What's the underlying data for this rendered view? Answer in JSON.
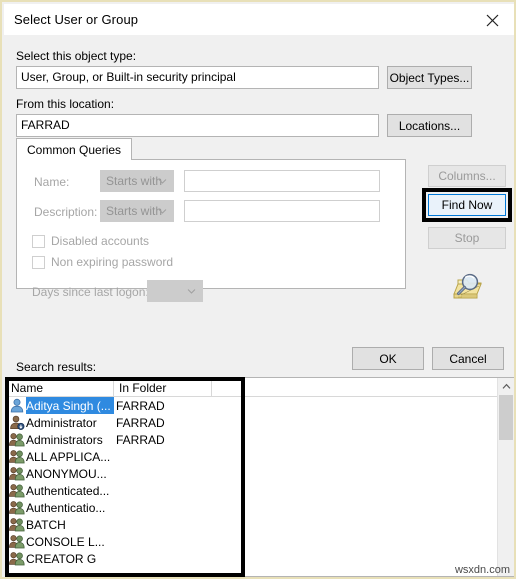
{
  "window": {
    "title": "Select User or Group",
    "close_icon": "close-icon"
  },
  "object_type": {
    "label": "Select this object type:",
    "value": "User, Group, or Built-in security principal",
    "button": "Object Types..."
  },
  "location": {
    "label": "From this location:",
    "value": "FARRAD",
    "button": "Locations..."
  },
  "tabs": [
    {
      "label": "Common Queries",
      "active": true
    }
  ],
  "query": {
    "name_label": "Name:",
    "name_operator": "Starts with",
    "name_value": "",
    "description_label": "Description:",
    "description_operator": "Starts with",
    "description_value": "",
    "disabled_accounts_label": "Disabled accounts",
    "disabled_accounts_checked": false,
    "non_expiring_label": "Non expiring password",
    "non_expiring_checked": false,
    "days_label": "Days since last logon:",
    "days_value": ""
  },
  "side_buttons": {
    "columns": "Columns...",
    "find_now": "Find Now",
    "stop": "Stop",
    "search_icon": "magnifier-folder-icon"
  },
  "dialog_buttons": {
    "ok": "OK",
    "cancel": "Cancel"
  },
  "results": {
    "label": "Search results:",
    "columns": [
      "Name",
      "In Folder"
    ],
    "rows": [
      {
        "name": "Aditya Singh (...",
        "folder": "FARRAD",
        "icon": "user-icon",
        "selected": true
      },
      {
        "name": "Administrator",
        "folder": "FARRAD",
        "icon": "user-badge-icon",
        "selected": false
      },
      {
        "name": "Administrators",
        "folder": "FARRAD",
        "icon": "group-icon",
        "selected": false
      },
      {
        "name": "ALL APPLICA...",
        "folder": "",
        "icon": "group-icon",
        "selected": false
      },
      {
        "name": "ANONYMOU...",
        "folder": "",
        "icon": "group-icon",
        "selected": false
      },
      {
        "name": "Authenticated...",
        "folder": "",
        "icon": "group-icon",
        "selected": false
      },
      {
        "name": "Authenticatio...",
        "folder": "",
        "icon": "group-icon",
        "selected": false
      },
      {
        "name": "BATCH",
        "folder": "",
        "icon": "group-icon",
        "selected": false
      },
      {
        "name": "CONSOLE L...",
        "folder": "",
        "icon": "group-icon",
        "selected": false
      },
      {
        "name": "CREATOR G",
        "folder": "",
        "icon": "group-icon",
        "selected": false
      }
    ]
  },
  "watermark": "wsxdn.com",
  "colors": {
    "selection": "#2f8ae0",
    "focus": "#0078d7",
    "annotation": "#000000",
    "border_outer": "#e8e0b8"
  }
}
